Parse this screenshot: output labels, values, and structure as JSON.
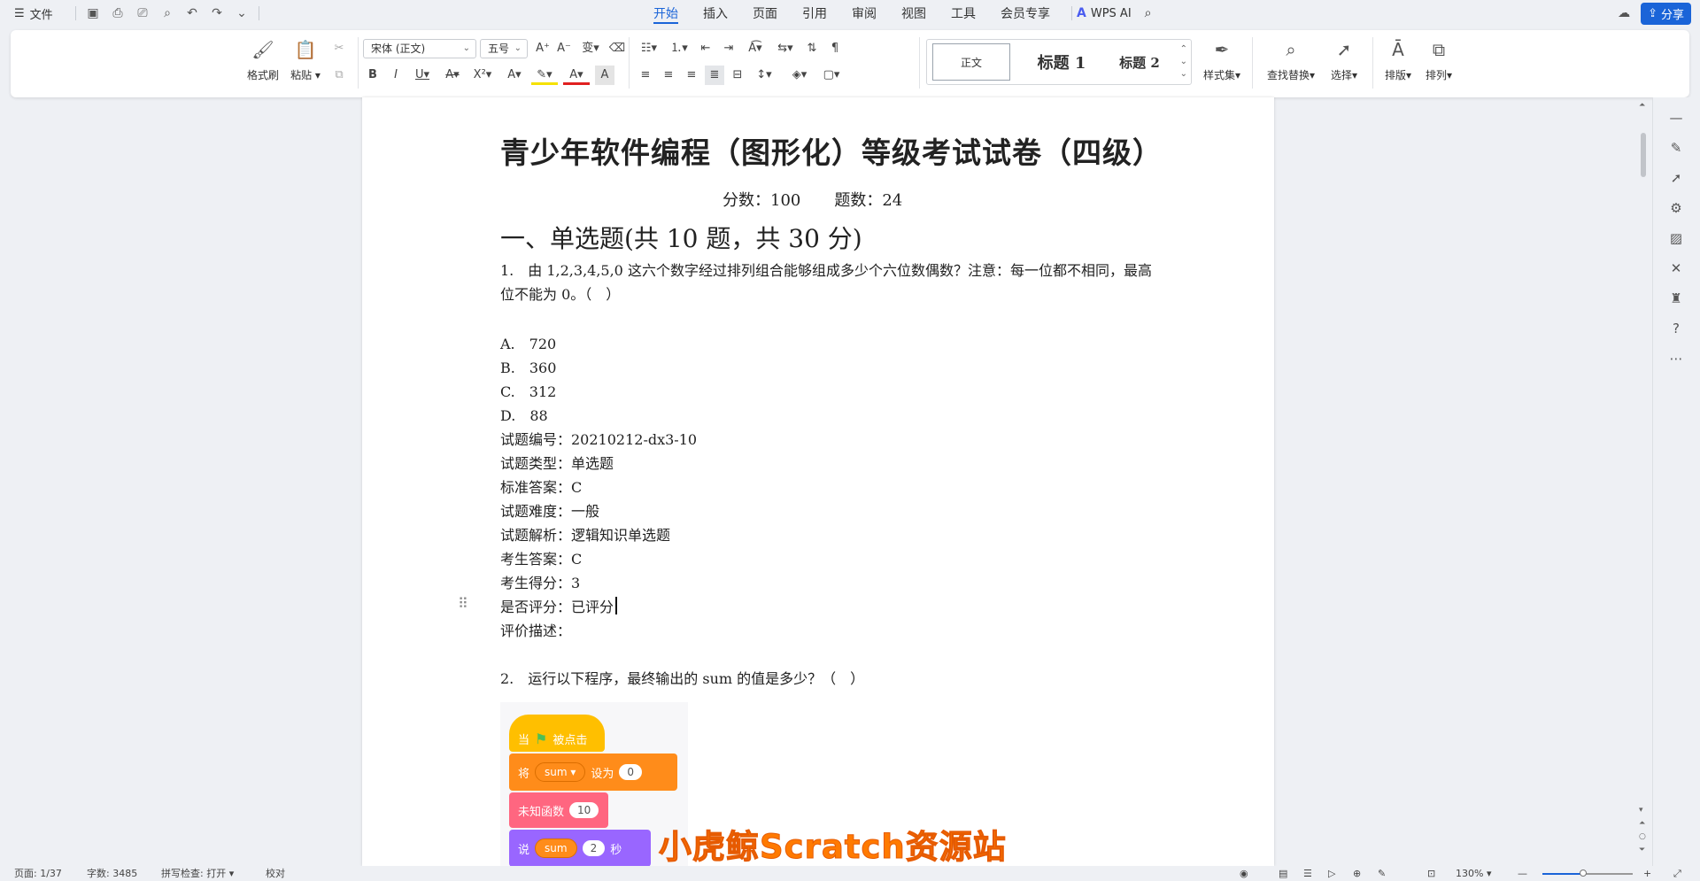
{
  "menu": {
    "file_icon": "hamburger-icon",
    "file_label": "文件"
  },
  "tabs": [
    {
      "label": "开始",
      "active": true
    },
    {
      "label": "插入"
    },
    {
      "label": "页面"
    },
    {
      "label": "引用"
    },
    {
      "label": "审阅"
    },
    {
      "label": "视图"
    },
    {
      "label": "工具"
    },
    {
      "label": "会员专享"
    }
  ],
  "wps_ai": "WPS AI",
  "share_label": "分享",
  "ribbon": {
    "format_painter": "格式刷",
    "paste": "粘贴",
    "font_name": "宋体 (正文)",
    "font_size": "五号",
    "styles": {
      "normal": "正文",
      "h1": "标题 1",
      "h2": "标题 2"
    },
    "style_set": "样式集",
    "find_replace": "查找替换",
    "select": "选择",
    "layout": "排版",
    "arrange": "排列"
  },
  "document": {
    "title": "青少年软件编程（图形化）等级考试试卷（四级）",
    "score_label": "分数：100",
    "count_label": "题数：24",
    "section_title": "一、单选题(共 10 题，共 30 分)",
    "q1_text": "1.　由 1,2,3,4,5,0 这六个数字经过排列组合能够组成多少个六位数偶数？注意：每一位都不相同，最高位不能为 0。（　）",
    "options": [
      "A.　720",
      "B.　360",
      "C.　312",
      "D.　88"
    ],
    "info_lines": [
      "试题编号：20210212-dx3-10",
      "试题类型：单选题",
      "标准答案：C",
      "试题难度：一般",
      "试题解析：逻辑知识单选题",
      "考生答案：C",
      "考生得分：3",
      "是否评分：已评分",
      "评价描述："
    ],
    "q2_text": "2.　运行以下程序，最终输出的 sum 的值是多少？（　）"
  },
  "scratch": {
    "hat_when": "当",
    "hat_clicked": "被点击",
    "set_label": "将",
    "set_var": "sum",
    "set_to": "设为",
    "set_value": "0",
    "func_label": "未知函数",
    "func_value": "10",
    "say_label": "说",
    "say_var": "sum",
    "say_secs": "2",
    "say_unit": "秒"
  },
  "watermark": "小虎鲸Scratch资源站",
  "statusbar": {
    "page": "页面: 1/37",
    "words": "字数: 3485",
    "spell": "拼写检查: 打开",
    "proof": "校对",
    "zoom": "130%",
    "zoom_level": 0.45
  }
}
